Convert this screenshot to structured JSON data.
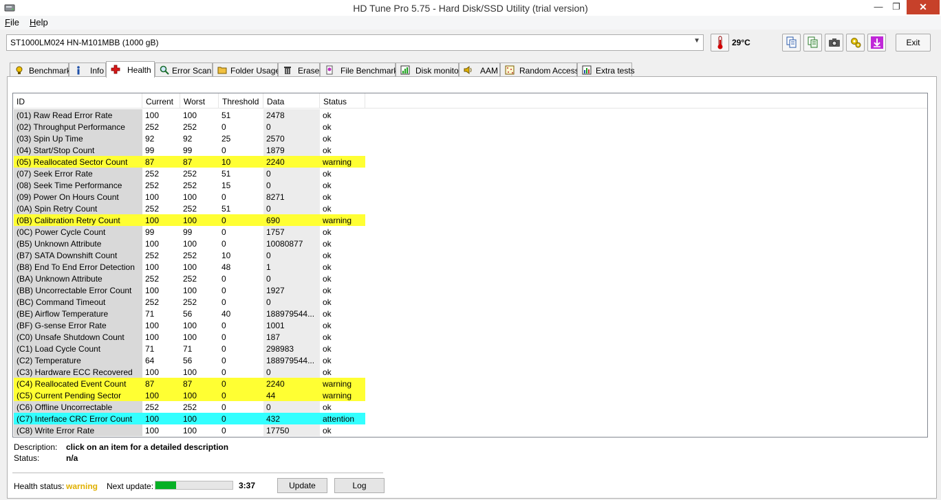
{
  "window": {
    "title": "HD Tune Pro 5.75 - Hard Disk/SSD Utility (trial version)"
  },
  "menu": [
    {
      "label": "File",
      "key": "F",
      "rest": "ile"
    },
    {
      "label": "Help",
      "key": "H",
      "rest": "elp"
    }
  ],
  "drive": {
    "selected": "ST1000LM024 HN-M101MBB (1000 gB)"
  },
  "temperature": "29°C",
  "toolbar": {
    "exit_label": "Exit"
  },
  "tabs": [
    {
      "label": "Benchmark",
      "icon": "benchmark-icon"
    },
    {
      "label": "Info",
      "icon": "info-icon"
    },
    {
      "label": "Health",
      "icon": "health-cross-icon",
      "active": true
    },
    {
      "label": "Error Scan",
      "icon": "magnifier-icon"
    },
    {
      "label": "Folder Usage",
      "icon": "folder-icon"
    },
    {
      "label": "Erase",
      "icon": "trash-icon"
    },
    {
      "label": "File Benchmark",
      "icon": "file-benchmark-icon"
    },
    {
      "label": "Disk monitor",
      "icon": "disk-monitor-icon"
    },
    {
      "label": "AAM",
      "icon": "speaker-icon"
    },
    {
      "label": "Random Access",
      "icon": "random-access-icon"
    },
    {
      "label": "Extra tests",
      "icon": "extra-tests-icon"
    }
  ],
  "table": {
    "columns": [
      "ID",
      "Current",
      "Worst",
      "Threshold",
      "Data",
      "Status"
    ],
    "rows": [
      [
        "(01) Raw Read Error Rate",
        "100",
        "100",
        "51",
        "2478",
        "ok"
      ],
      [
        "(02) Throughput Performance",
        "252",
        "252",
        "0",
        "0",
        "ok"
      ],
      [
        "(03) Spin Up Time",
        "92",
        "92",
        "25",
        "2570",
        "ok"
      ],
      [
        "(04) Start/Stop Count",
        "99",
        "99",
        "0",
        "1879",
        "ok"
      ],
      [
        "(05) Reallocated Sector Count",
        "87",
        "87",
        "10",
        "2240",
        "warning"
      ],
      [
        "(07) Seek Error Rate",
        "252",
        "252",
        "51",
        "0",
        "ok"
      ],
      [
        "(08) Seek Time Performance",
        "252",
        "252",
        "15",
        "0",
        "ok"
      ],
      [
        "(09) Power On Hours Count",
        "100",
        "100",
        "0",
        "8271",
        "ok"
      ],
      [
        "(0A) Spin Retry Count",
        "252",
        "252",
        "51",
        "0",
        "ok"
      ],
      [
        "(0B) Calibration Retry Count",
        "100",
        "100",
        "0",
        "690",
        "warning"
      ],
      [
        "(0C) Power Cycle Count",
        "99",
        "99",
        "0",
        "1757",
        "ok"
      ],
      [
        "(B5) Unknown Attribute",
        "100",
        "100",
        "0",
        "10080877",
        "ok"
      ],
      [
        "(B7) SATA Downshift Count",
        "252",
        "252",
        "10",
        "0",
        "ok"
      ],
      [
        "(B8) End To End Error Detection",
        "100",
        "100",
        "48",
        "1",
        "ok"
      ],
      [
        "(BA) Unknown Attribute",
        "252",
        "252",
        "0",
        "0",
        "ok"
      ],
      [
        "(BB) Uncorrectable Error Count",
        "100",
        "100",
        "0",
        "1927",
        "ok"
      ],
      [
        "(BC) Command Timeout",
        "252",
        "252",
        "0",
        "0",
        "ok"
      ],
      [
        "(BE) Airflow Temperature",
        "71",
        "56",
        "40",
        "188979544...",
        "ok"
      ],
      [
        "(BF) G-sense Error Rate",
        "100",
        "100",
        "0",
        "1001",
        "ok"
      ],
      [
        "(C0) Unsafe Shutdown Count",
        "100",
        "100",
        "0",
        "187",
        "ok"
      ],
      [
        "(C1) Load Cycle Count",
        "71",
        "71",
        "0",
        "298983",
        "ok"
      ],
      [
        "(C2) Temperature",
        "64",
        "56",
        "0",
        "188979544...",
        "ok"
      ],
      [
        "(C3) Hardware ECC Recovered",
        "100",
        "100",
        "0",
        "0",
        "ok"
      ],
      [
        "(C4) Reallocated Event Count",
        "87",
        "87",
        "0",
        "2240",
        "warning"
      ],
      [
        "(C5) Current Pending Sector",
        "100",
        "100",
        "0",
        "44",
        "warning"
      ],
      [
        "(C6) Offline Uncorrectable",
        "252",
        "252",
        "0",
        "0",
        "ok"
      ],
      [
        "(C7) Interface CRC Error Count",
        "100",
        "100",
        "0",
        "432",
        "attention"
      ],
      [
        "(C8) Write Error Rate",
        "100",
        "100",
        "0",
        "17750",
        "ok"
      ]
    ]
  },
  "details": {
    "description_label": "Description:",
    "description_value": "click on an item for a detailed description",
    "status_label": "Status:",
    "status_value": "n/a"
  },
  "footer": {
    "health_label": "Health status:",
    "health_value": "warning",
    "next_update_label": "Next update:",
    "next_update_progress": 0.27,
    "next_update_time": "3:37",
    "update_button": "Update",
    "log_button": "Log"
  },
  "colors": {
    "warning_row": "#ffff33",
    "attention_row": "#33ffff",
    "close_button": "#c7412a",
    "progress_fill": "#06b025"
  }
}
